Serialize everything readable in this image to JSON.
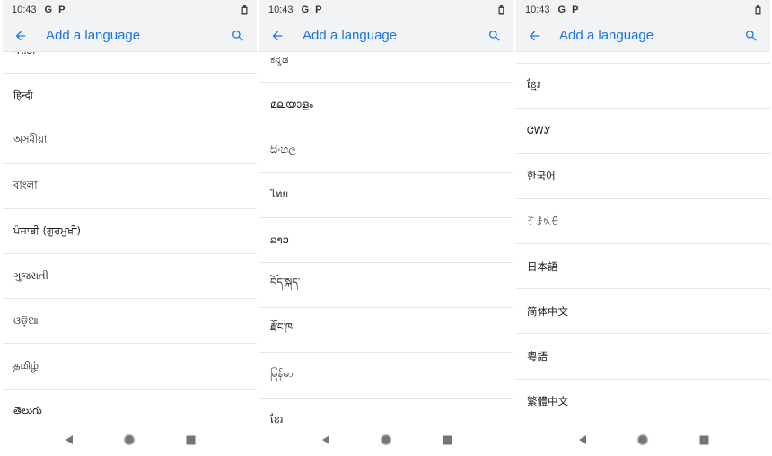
{
  "status_bar": {
    "time": "10:43",
    "icon_g": "G",
    "icon_p": "P"
  },
  "app_bar": {
    "title": "Add a language"
  },
  "phones": [
    {
      "languages": [
        "मराठी",
        "हिन्दी",
        "অসমীয়া",
        "বাংলা",
        "ਪੰਜਾਬੀ (ਗੁਰਮੁਖੀ)",
        "ગુજરાતી",
        "ଓଡ଼ିଆ",
        "தமிழ்",
        "తెలుగు"
      ]
    },
    {
      "languages": [
        "ಕನ್ನಡ",
        "മലയാളം",
        "සිංහල",
        "ไทย",
        "ລາວ",
        "བོད་སྐད་",
        "རྫོང་ཁ",
        "မြန်မာ",
        "ខ្មែរ"
      ]
    },
    {
      "languages": [
        "",
        "ខ្មែរ",
        "ᏣᎳᎩ",
        "한국어",
        "ꆈꌠꁱꂷ",
        "日本語",
        "简体中文",
        "粵語",
        "繁體中文"
      ]
    }
  ],
  "icons": {
    "back": "arrow-back-icon",
    "search": "search-icon",
    "battery": "battery-icon",
    "nav_back": "triangle-back-icon",
    "nav_home": "circle-home-icon",
    "nav_recents": "square-recents-icon"
  },
  "colors": {
    "accent": "#1a73e8",
    "bar_bg": "#f1f3f4",
    "nav_icon": "#757575"
  }
}
